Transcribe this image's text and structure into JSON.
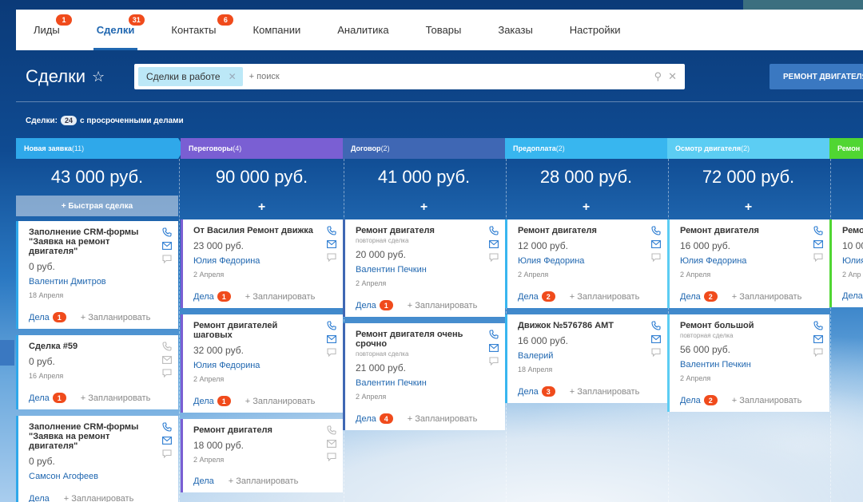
{
  "nav": {
    "tabs": [
      {
        "label": "Лиды",
        "badge": "1"
      },
      {
        "label": "Сделки",
        "badge": "31"
      },
      {
        "label": "Контакты",
        "badge": "6"
      },
      {
        "label": "Компании",
        "badge": ""
      },
      {
        "label": "Аналитика",
        "badge": ""
      },
      {
        "label": "Товары",
        "badge": ""
      },
      {
        "label": "Заказы",
        "badge": ""
      },
      {
        "label": "Настройки",
        "badge": ""
      }
    ],
    "active_tab": "Сделки"
  },
  "header": {
    "title": "Сделки",
    "filter_chip": "Сделки в работе",
    "search_placeholder": "+ поиск",
    "action_button": "РЕМОНТ ДВИГАТЕЛЯ"
  },
  "summary": {
    "label": "Сделки:",
    "count": "24",
    "suffix": "с просроченными делами"
  },
  "quick_deal_label": "+ Быстрая сделка",
  "plan_label": "+ Запланировать",
  "dela_label": "Дела",
  "colors": {
    "new": "#2fa8ea",
    "negotiations": "#7a5fd3",
    "contract": "#3f67b4",
    "prepayment": "#38b6ef",
    "inspection": "#5ccdf3",
    "next": "#50d632"
  },
  "columns": [
    {
      "title": "Новая заявка",
      "count": "(11)",
      "sum": "43 000 руб.",
      "cards": [
        {
          "title": "Заполнение CRM-формы \"Заявка на ремонт двигателя\"",
          "sub": "",
          "price": "0 руб.",
          "person": "Валентин Дмитров",
          "date": "18 Апреля",
          "dela": "1"
        },
        {
          "title": "Сделка #59",
          "sub": "",
          "price": "0 руб.",
          "person": "",
          "date": "16 Апреля",
          "dela": "1"
        },
        {
          "title": "Заполнение CRM-формы \"Заявка на ремонт двигателя\"",
          "sub": "",
          "price": "0 руб.",
          "person": "Самсон Агофеев",
          "date": "",
          "dela": ""
        }
      ]
    },
    {
      "title": "Переговоры",
      "count": "(4)",
      "sum": "90 000 руб.",
      "cards": [
        {
          "title": "От Василия Ремонт движка",
          "sub": "",
          "price": "23 000 руб.",
          "person": "Юлия Федорина",
          "date": "2 Апреля",
          "dela": "1"
        },
        {
          "title": "Ремонт двигателей шаговых",
          "sub": "",
          "price": "32 000 руб.",
          "person": "Юлия Федорина",
          "date": "2 Апреля",
          "dela": "1"
        },
        {
          "title": "Ремонт двигателя",
          "sub": "",
          "price": "18 000 руб.",
          "person": "",
          "date": "2 Апреля",
          "dela": ""
        }
      ]
    },
    {
      "title": "Договор",
      "count": "(2)",
      "sum": "41 000 руб.",
      "cards": [
        {
          "title": "Ремонт двигателя",
          "sub": "повторная сделка",
          "price": "20 000 руб.",
          "person": "Валентин Печкин",
          "date": "2 Апреля",
          "dela": "1"
        },
        {
          "title": "Ремонт двигателя очень срочно",
          "sub": "повторная сделка",
          "price": "21 000 руб.",
          "person": "Валентин Печкин",
          "date": "2 Апреля",
          "dela": "4"
        }
      ]
    },
    {
      "title": "Предоплата",
      "count": "(2)",
      "sum": "28 000 руб.",
      "cards": [
        {
          "title": "Ремонт двигателя",
          "sub": "",
          "price": "12 000 руб.",
          "person": "Юлия Федорина",
          "date": "2 Апреля",
          "dela": "2"
        },
        {
          "title": "Движок №576786 AMT",
          "sub": "",
          "price": "16 000 руб.",
          "person": "Валерий",
          "date": "18 Апреля",
          "dela": "3"
        }
      ]
    },
    {
      "title": "Осмотр двигателя",
      "count": "(2)",
      "sum": "72 000 руб.",
      "cards": [
        {
          "title": "Ремонт двигателя",
          "sub": "",
          "price": "16 000 руб.",
          "person": "Юлия Федорина",
          "date": "2 Апреля",
          "dela": "2"
        },
        {
          "title": "Ремонт большой",
          "sub": "повторная сделка",
          "price": "56 000 руб.",
          "person": "Валентин Печкин",
          "date": "2 Апреля",
          "dela": "2"
        }
      ]
    },
    {
      "title": "Ремон",
      "count": "",
      "sum": "10",
      "cards": [
        {
          "title": "Ремо",
          "sub": "",
          "price": "10 00",
          "person": "Юлия",
          "date": "2 Апр",
          "dela": ""
        }
      ]
    }
  ]
}
